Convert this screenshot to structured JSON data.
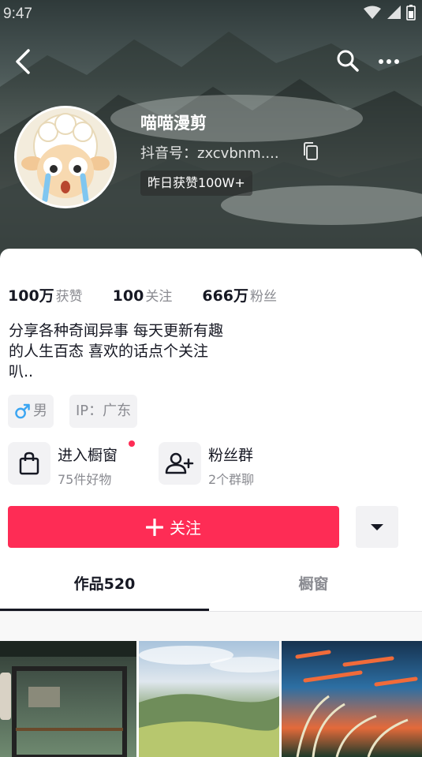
{
  "status_bar": {
    "time": "9:47"
  },
  "profile": {
    "nickname": "喵喵漫剪",
    "douyin_id": "抖音号：zxcvbnm....",
    "likes_pill": "昨日获赞100W+"
  },
  "stats": [
    {
      "value": "100万",
      "label": "获赞"
    },
    {
      "value": "100",
      "label": "关注"
    },
    {
      "value": "666万",
      "label": "粉丝"
    }
  ],
  "bio": "分享各种奇闻异事 每天更新有趣\n的人生百态 喜欢的话点个关注\n叭..",
  "tags": {
    "gender": "男",
    "ip": "IP：广东"
  },
  "entries": {
    "shop": {
      "title": "进入橱窗",
      "subtitle": "75件好物"
    },
    "fans": {
      "title": "粉丝群",
      "subtitle": "2个群聊"
    }
  },
  "actions": {
    "follow": "关注"
  },
  "tabs": [
    {
      "label": "作品520",
      "active": true
    },
    {
      "label": "橱窗",
      "active": false
    }
  ],
  "colors": {
    "accent": "#fe2c55",
    "text": "#161823",
    "muted": "#8a8b91",
    "gender_icon": "#3aa5f2"
  },
  "icons": [
    "back-icon",
    "search-icon",
    "more-icon",
    "copy-icon",
    "male-icon",
    "shopping-bag-icon",
    "add-group-icon",
    "plus-icon",
    "caret-down-icon",
    "wifi-icon",
    "signal-icon",
    "battery-icon"
  ]
}
